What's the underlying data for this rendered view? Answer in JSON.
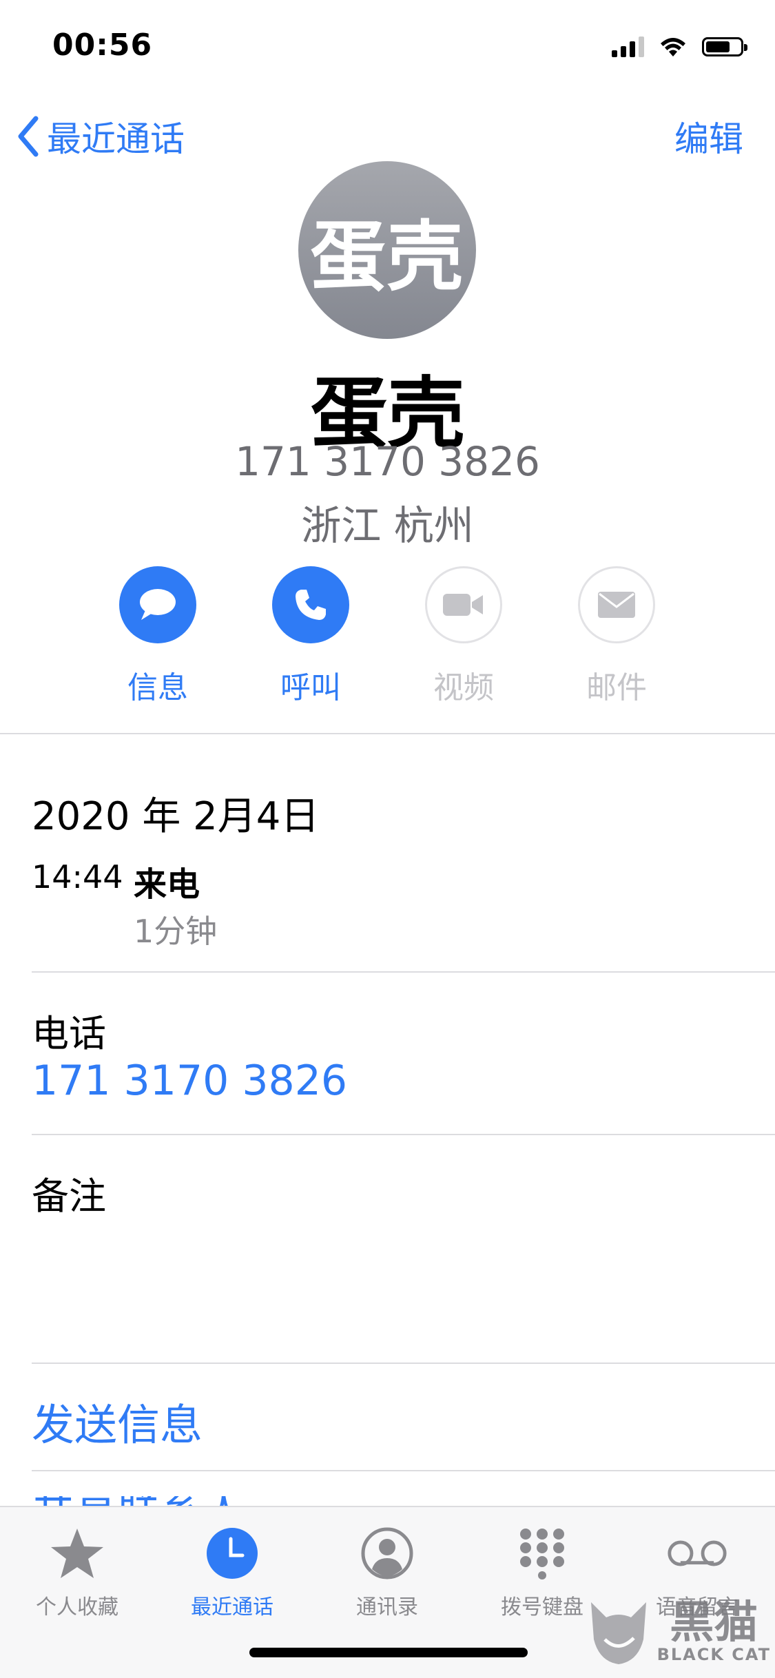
{
  "status_bar": {
    "time": "00:56"
  },
  "nav": {
    "back_label": "最近通话",
    "edit_label": "编辑"
  },
  "contact": {
    "avatar_text": "蛋壳",
    "name": "蛋壳",
    "number": "171 3170 3826",
    "location": "浙江 杭州"
  },
  "actions": [
    {
      "label": "信息",
      "enabled": true,
      "icon": "message-icon"
    },
    {
      "label": "呼叫",
      "enabled": true,
      "icon": "phone-icon"
    },
    {
      "label": "视频",
      "enabled": false,
      "icon": "video-icon"
    },
    {
      "label": "邮件",
      "enabled": false,
      "icon": "mail-icon"
    }
  ],
  "call_history": {
    "date": "2020 年 2月4日",
    "time": "14:44",
    "type": "来电",
    "duration": "1分钟"
  },
  "phone_section": {
    "label": "电话",
    "value": "171 3170 3826"
  },
  "notes_section": {
    "label": "备注"
  },
  "send_message_label": "发送信息",
  "partial_row_label": "共享联系人",
  "tab_bar": {
    "tabs": [
      {
        "label": "个人收藏",
        "icon": "star-icon",
        "active": false
      },
      {
        "label": "最近通话",
        "icon": "clock-icon",
        "active": true
      },
      {
        "label": "通讯录",
        "icon": "person-circle-icon",
        "active": false
      },
      {
        "label": "拨号键盘",
        "icon": "keypad-icon",
        "active": false
      },
      {
        "label": "语音留言",
        "icon": "voicemail-icon",
        "active": false
      }
    ]
  },
  "watermark": {
    "cn": "黑猫",
    "en": "BLACK CAT"
  },
  "colors": {
    "accent": "#2f7bf5",
    "secondary_text": "#6d6d72",
    "disabled": "#c4c4c8"
  }
}
